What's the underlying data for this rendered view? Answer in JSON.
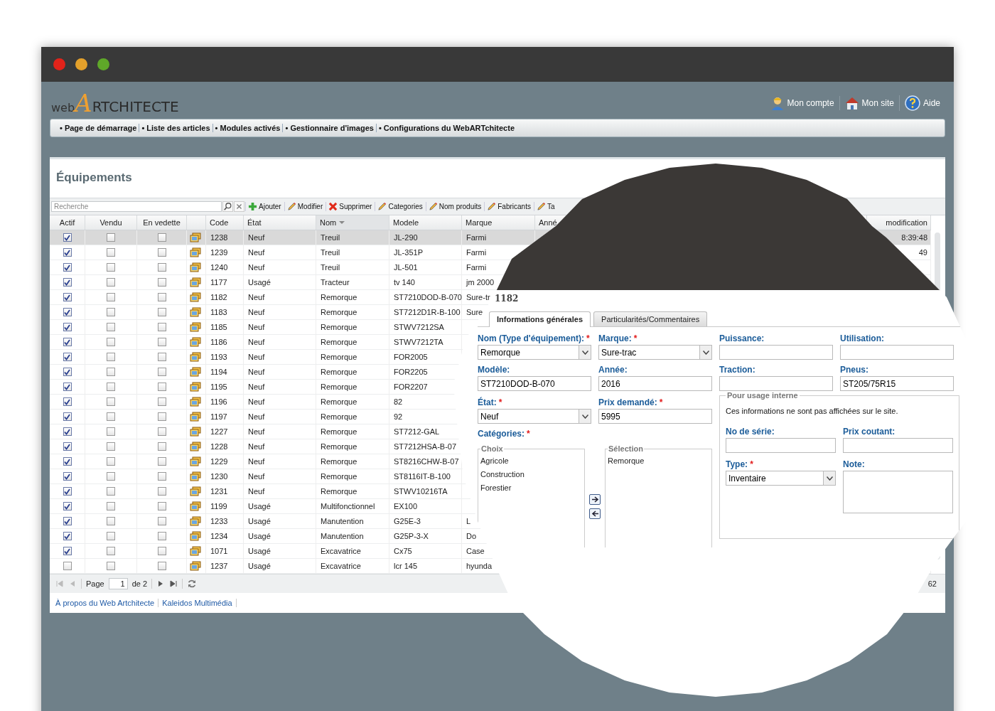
{
  "logo": {
    "prefix": "web",
    "initial": "A",
    "rest": "RTCHITECTE"
  },
  "header_links": [
    {
      "kind": "account",
      "label": "Mon compte"
    },
    {
      "kind": "site",
      "label": "Mon site"
    },
    {
      "kind": "help",
      "label": "Aide"
    }
  ],
  "nav": [
    "• Page de démarrage",
    "• Liste des articles",
    "• Modules activés",
    "• Gestionnaire d'images",
    "• Configurations du WebARTchitecte"
  ],
  "panel_title": "Équipements",
  "search": {
    "placeholder": "Recherche"
  },
  "toolbar": [
    {
      "kind": "add",
      "label": "Ajouter"
    },
    {
      "kind": "edit",
      "label": "Modifier"
    },
    {
      "kind": "delete",
      "label": "Supprimer"
    },
    {
      "kind": "edit",
      "label": "Categories"
    },
    {
      "kind": "edit",
      "label": "Nom produits"
    },
    {
      "kind": "edit",
      "label": "Fabricants"
    },
    {
      "kind": "edit",
      "label": "Ta"
    }
  ],
  "table": {
    "columns": [
      {
        "label": "Actif",
        "sorted": false
      },
      {
        "label": "Vendu",
        "sorted": false
      },
      {
        "label": "En vedette",
        "sorted": false
      },
      {
        "sorted": false
      },
      {
        "label": "Code",
        "sorted": false
      },
      {
        "label": "État",
        "sorted": false
      },
      {
        "label": "Nom",
        "sorted": true
      },
      {
        "label": "Modele",
        "sorted": false
      },
      {
        "label": "Marque",
        "sorted": false
      },
      {
        "label": "Anné",
        "sorted": false
      },
      {
        "label": "modification",
        "sorted": false
      }
    ],
    "rows": [
      {
        "selected": true,
        "actif": true,
        "vendu": false,
        "vedette": false,
        "code": "1238",
        "etat": "Neuf",
        "nom": "Treuil",
        "modele": "JL-290",
        "marque": "Farmi",
        "modification": "8:39:48"
      },
      {
        "selected": false,
        "actif": true,
        "vendu": false,
        "vedette": false,
        "code": "1239",
        "etat": "Neuf",
        "nom": "Treuil",
        "modele": "JL-351P",
        "marque": "Farmi",
        "modification": "49"
      },
      {
        "selected": false,
        "actif": true,
        "vendu": false,
        "vedette": false,
        "code": "1240",
        "etat": "Neuf",
        "nom": "Treuil",
        "modele": "JL-501",
        "marque": "Farmi"
      },
      {
        "selected": false,
        "actif": true,
        "vendu": false,
        "vedette": false,
        "code": "1177",
        "etat": "Usagé",
        "nom": "Tracteur",
        "modele": "tv 140",
        "marque": "jm 2000"
      },
      {
        "selected": false,
        "actif": true,
        "vendu": false,
        "vedette": false,
        "code": "1182",
        "etat": "Neuf",
        "nom": "Remorque",
        "modele": "ST7210DOD-B-070",
        "marque": "Sure-tr"
      },
      {
        "selected": false,
        "actif": true,
        "vendu": false,
        "vedette": false,
        "code": "1183",
        "etat": "Neuf",
        "nom": "Remorque",
        "modele": "ST7212D1R-B-100",
        "marque": "Sure"
      },
      {
        "selected": false,
        "actif": true,
        "vendu": false,
        "vedette": false,
        "code": "1185",
        "etat": "Neuf",
        "nom": "Remorque",
        "modele": "STWV7212SA"
      },
      {
        "selected": false,
        "actif": true,
        "vendu": false,
        "vedette": false,
        "code": "1186",
        "etat": "Neuf",
        "nom": "Remorque",
        "modele": "STWV7212TA"
      },
      {
        "selected": false,
        "actif": true,
        "vendu": false,
        "vedette": false,
        "code": "1193",
        "etat": "Neuf",
        "nom": "Remorque",
        "modele": "FOR2005"
      },
      {
        "selected": false,
        "actif": true,
        "vendu": false,
        "vedette": false,
        "code": "1194",
        "etat": "Neuf",
        "nom": "Remorque",
        "modele": "FOR2205"
      },
      {
        "selected": false,
        "actif": true,
        "vendu": false,
        "vedette": false,
        "code": "1195",
        "etat": "Neuf",
        "nom": "Remorque",
        "modele": "FOR2207"
      },
      {
        "selected": false,
        "actif": true,
        "vendu": false,
        "vedette": false,
        "code": "1196",
        "etat": "Neuf",
        "nom": "Remorque",
        "modele": "82"
      },
      {
        "selected": false,
        "actif": true,
        "vendu": false,
        "vedette": false,
        "code": "1197",
        "etat": "Neuf",
        "nom": "Remorque",
        "modele": "92"
      },
      {
        "selected": false,
        "actif": true,
        "vendu": false,
        "vedette": false,
        "code": "1227",
        "etat": "Neuf",
        "nom": "Remorque",
        "modele": "ST7212-GAL"
      },
      {
        "selected": false,
        "actif": true,
        "vendu": false,
        "vedette": false,
        "code": "1228",
        "etat": "Neuf",
        "nom": "Remorque",
        "modele": "ST7212HSA-B-07"
      },
      {
        "selected": false,
        "actif": true,
        "vendu": false,
        "vedette": false,
        "code": "1229",
        "etat": "Neuf",
        "nom": "Remorque",
        "modele": "ST8216CHW-B-07"
      },
      {
        "selected": false,
        "actif": true,
        "vendu": false,
        "vedette": false,
        "code": "1230",
        "etat": "Neuf",
        "nom": "Remorque",
        "modele": "ST8116IT-B-100"
      },
      {
        "selected": false,
        "actif": true,
        "vendu": false,
        "vedette": false,
        "code": "1231",
        "etat": "Neuf",
        "nom": "Remorque",
        "modele": "STWV10216TA"
      },
      {
        "selected": false,
        "actif": true,
        "vendu": false,
        "vedette": false,
        "code": "1199",
        "etat": "Usagé",
        "nom": "Multifonctionnel",
        "modele": "EX100"
      },
      {
        "selected": false,
        "actif": true,
        "vendu": false,
        "vedette": false,
        "code": "1233",
        "etat": "Usagé",
        "nom": "Manutention",
        "modele": "G25E-3",
        "marque": "L"
      },
      {
        "selected": false,
        "actif": true,
        "vendu": false,
        "vedette": false,
        "code": "1234",
        "etat": "Usagé",
        "nom": "Manutention",
        "modele": "G25P-3-X",
        "marque": "Do"
      },
      {
        "selected": false,
        "actif": true,
        "vendu": false,
        "vedette": false,
        "code": "1071",
        "etat": "Usagé",
        "nom": "Excavatrice",
        "modele": "Cx75",
        "marque": "Case"
      },
      {
        "selected": false,
        "actif": false,
        "vendu": false,
        "vedette": false,
        "code": "1237",
        "etat": "Usagé",
        "nom": "Excavatrice",
        "modele": "lcr 145",
        "marque": "hyunda"
      }
    ]
  },
  "pager": {
    "label": "Page",
    "page": "1",
    "of": "de 2",
    "summary": "62"
  },
  "footer_links": [
    "À propos du Web Artchitecte",
    "Kaleidos Multimédia"
  ],
  "magnifier": {
    "record": "1182",
    "tabs": [
      {
        "label": "Informations générales",
        "selected": true
      },
      {
        "label": "Particularités/Commentaires",
        "selected": false
      }
    ],
    "top_fields": [
      {
        "label": "Nom (Type d'équipement):",
        "required_mark": "*",
        "kind": "select",
        "value": "Remorque"
      },
      {
        "label": "Marque:",
        "required_mark": "*",
        "kind": "select",
        "value": "Sure-trac"
      },
      {
        "label": "Puissance:",
        "kind": "input"
      },
      {
        "label": "Utilisation:",
        "kind": "input"
      },
      {
        "label": "Modèle:",
        "kind": "input",
        "value": "ST7210DOD-B-070"
      },
      {
        "label": "Année:",
        "kind": "input",
        "value": "2016"
      },
      {
        "label": "Traction:",
        "kind": "input"
      },
      {
        "label": "Pneus:",
        "kind": "input",
        "value": "ST205/75R15"
      }
    ],
    "left_fields": [
      {
        "label": "État:",
        "required_mark": "*",
        "kind": "select",
        "value": "Neuf"
      },
      {
        "label": "Prix demandé:",
        "required_mark": "*",
        "kind": "input",
        "value": "5995"
      }
    ],
    "categories": {
      "label": "Catégories:",
      "required_mark": "*",
      "choice_title": "Choix",
      "choices": [
        "Agricole",
        "Construction",
        "Forestier"
      ],
      "selection_title": "Sélection",
      "selection": [
        "Remorque"
      ]
    },
    "internal": {
      "title": "Pour usage interne",
      "note": "Ces informations ne sont pas affichées sur le site.",
      "fields": [
        {
          "label": "No de série:",
          "kind": "input"
        },
        {
          "label": "Prix coutant:",
          "kind": "input"
        },
        {
          "label": "Type:",
          "required_mark": "*",
          "kind": "select",
          "value": "Inventaire"
        },
        {
          "label": "Note:",
          "kind": "textarea"
        }
      ]
    }
  }
}
